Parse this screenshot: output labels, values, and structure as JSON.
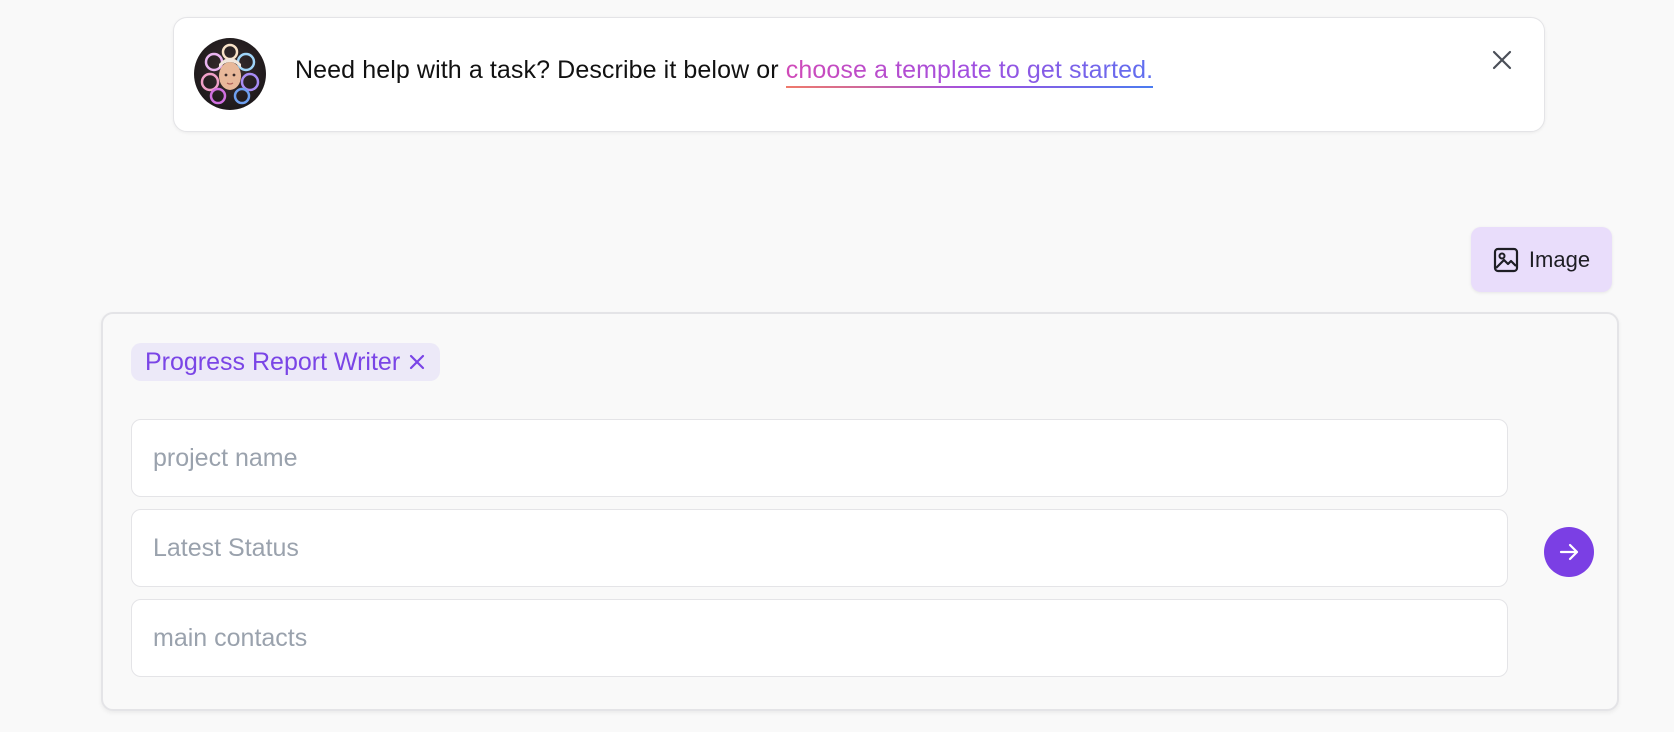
{
  "banner": {
    "text": "Need help with a task? Describe it below or ",
    "link_text": "choose a template to get started.",
    "avatar_icon": "ai-assistant-avatar",
    "close_icon": "close-icon"
  },
  "toolbar": {
    "image_label": "Image",
    "image_icon": "image-icon"
  },
  "form": {
    "template_chip": {
      "label": "Progress Report Writer",
      "remove_icon": "close-icon"
    },
    "fields": [
      {
        "placeholder": "project name",
        "value": ""
      },
      {
        "placeholder": "Latest Status",
        "value": ""
      },
      {
        "placeholder": "main contacts",
        "value": ""
      }
    ],
    "send_icon": "arrow-right-icon"
  },
  "colors": {
    "accent": "#7b3fe4",
    "chip_bg": "#ece9f8",
    "chip_text": "#7a45e6",
    "image_button_bg": "#e9ddfb",
    "link_gradient": [
      "#d04ab8",
      "#a24fe0",
      "#5d6ff0"
    ]
  }
}
